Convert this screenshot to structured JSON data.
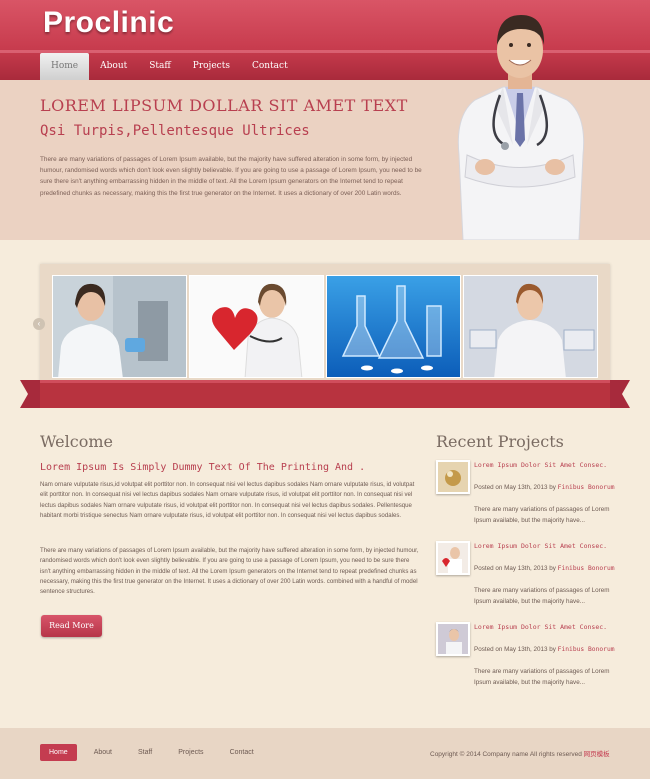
{
  "header": {
    "logo": "Proclinic",
    "nav": [
      "Home",
      "About",
      "Staff",
      "Projects",
      "Contact"
    ]
  },
  "hero": {
    "title": "LOREM LIPSUM DOLLAR SIT AMET TEXT",
    "subtitle": "Qsi Turpis,Pellentesque Ultrices",
    "body": "There are many variations of passages of Lorem Ipsum available, but the majority have suffered alteration in some form, by injected humour, randomised words which don't look even slightly believable. If you are going to use a passage of Lorem Ipsum, you need to be sure there isn't anything embarrassing hidden in the middle of text. All the Lorem Ipsum generators on the Internet tend to repeat predefined chunks as necessary, making this the first true generator on the Internet. It uses a dictionary of over 200 Latin words."
  },
  "gallery": {
    "prev_icon": "‹"
  },
  "welcome": {
    "title": "Welcome",
    "subtitle": "Lorem Ipsum Is Simply Dummy Text Of The Printing And .",
    "p1": "Nam ornare vulputate risus,id volutpat elit porttitor non. In consequat nisi vel lectus dapibus sodales Nam ornare vulputate risus, id volutpat elit porttitor non. In consequat nisi vel lectus dapibus sodales Nam ornare vulputate risus, id volutpat elit porttitor non. In consequat nisi vel lectus dapibus sodales Nam ornare vulputate risus, id volutpat elit porttitor non. In consequat nisi vel lectus dapibus sodales. Pellentesque habitant morbi tristique senectus Nam ornare vulputate risus, id volutpat elit porttitor non. In consequat nisi vel lectus dapibus sodales.",
    "p2": "There are many variations of passages of Lorem Ipsum available, but the majority have suffered alteration in some form, by injected humour, randomised words which don't look even slightly believable. If you are going to use a passage of Lorem Ipsum, you need to be sure there isn't anything embarrassing hidden in the middle of text. All the Lorem Ipsum generators on the Internet tend to repeat predefined chunks as necessary, making this the first true generator on the Internet. It uses a dictionary of over 200 Latin words. combined with a handful of model sentence structures.",
    "button": "Read More"
  },
  "recent": {
    "title": "Recent Projects",
    "items": [
      {
        "title": "Lorem Ipsum Dolor Sit Amet Consec.",
        "posted": "Posted on May 13th, 2013 by",
        "author": "Finibus Bonorum",
        "desc": "There are many variations of passages of Lorem Ipsum available, but the majority have..."
      },
      {
        "title": "Lorem Ipsum Dolor Sit Amet Consec.",
        "posted": "Posted on May 13th, 2013 by",
        "author": "Finibus Bonorum",
        "desc": "There are many variations of passages of Lorem Ipsum available, but the majority have..."
      },
      {
        "title": "Lorem Ipsum Dolor Sit Amet Consec.",
        "posted": "Posted on May 13th, 2013 by",
        "author": "Finibus Bonorum",
        "desc": "There are many variations of passages of Lorem Ipsum available, but the majority have..."
      }
    ]
  },
  "footer": {
    "nav": [
      "Home",
      "About",
      "Staff",
      "Projects",
      "Contact"
    ],
    "copyright": "Copyright © 2014 Company name All rights reserved",
    "copyright_cn": "网页模板"
  }
}
